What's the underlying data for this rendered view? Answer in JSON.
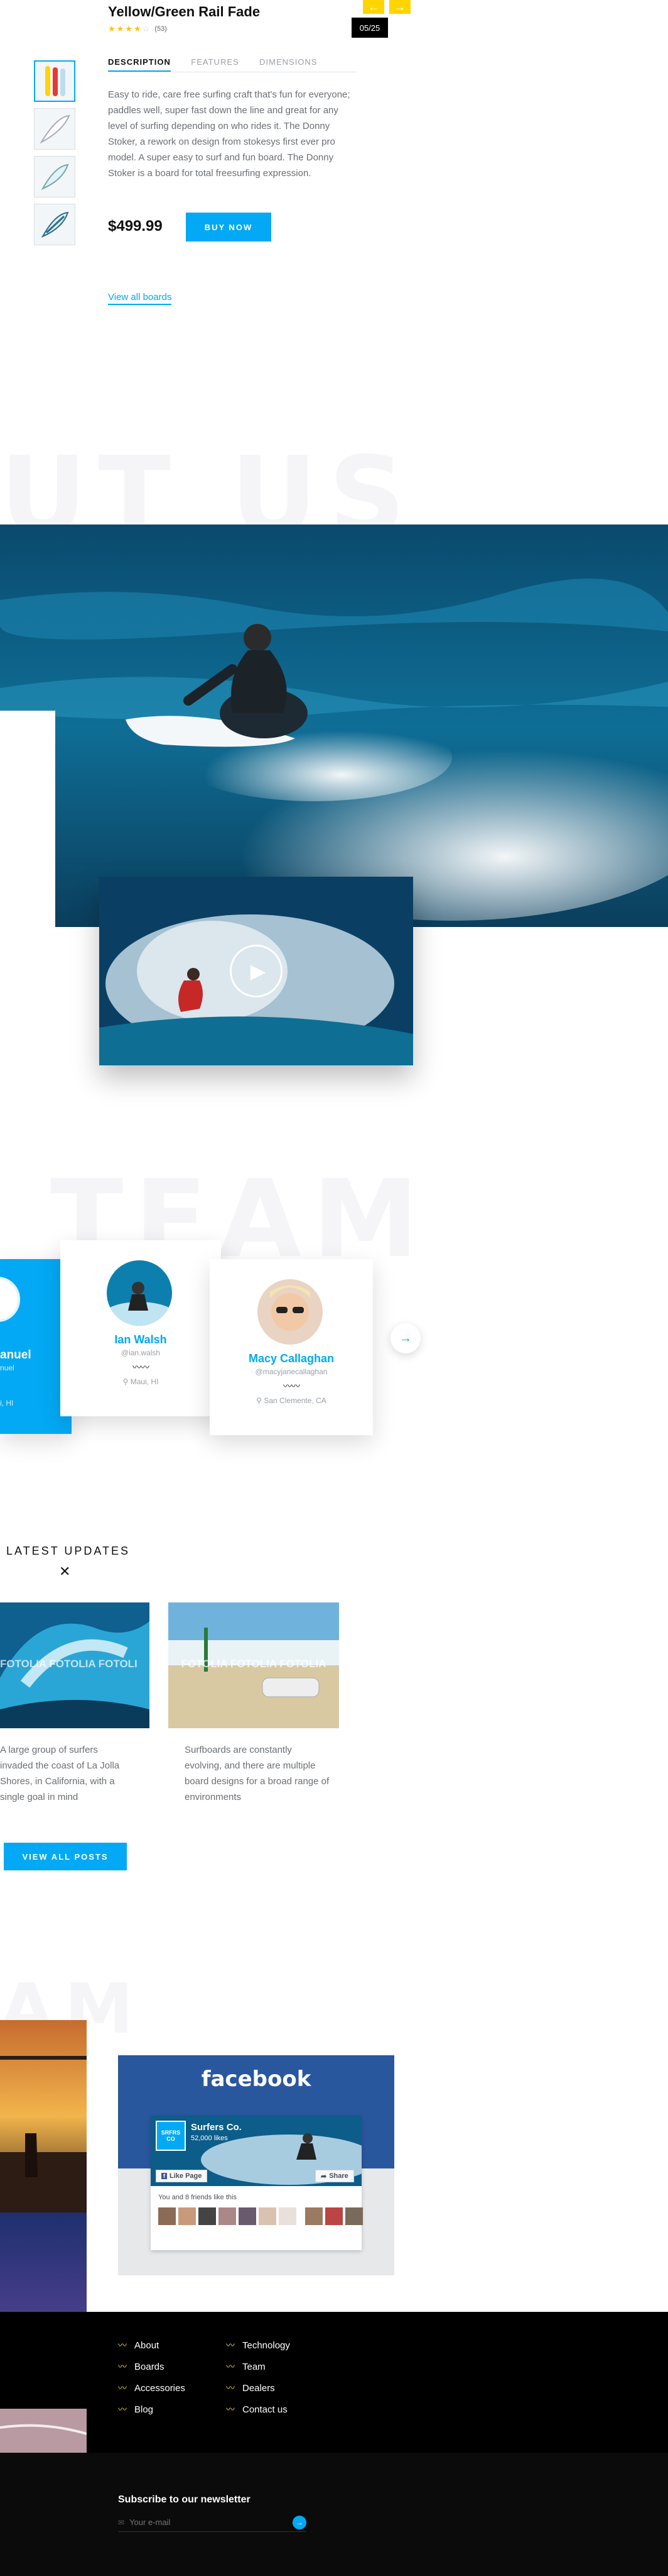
{
  "product": {
    "title": "Yellow/Green Rail Fade",
    "rating_stars": 4,
    "rating_count": "(53)",
    "counter": "05/25",
    "tabs": [
      "DESCRIPTION",
      "FEATURES",
      "DIMENSIONS"
    ],
    "description": "Easy to ride, care free surfing craft that's fun for everyone; paddles well, super fast down the line and great for any level of surfing depending on who rides it. The Donny Stoker, a rework on design from stokesys first ever pro model. A super easy to surf and fun board. The Donny Stoker is a board for total freesurfing expression.",
    "price": "$499.99",
    "buy_label": "BUY NOW",
    "view_all": "View all boards"
  },
  "about": {
    "bg_word": "UT US"
  },
  "team": {
    "bg_word": "TEAM",
    "members": [
      {
        "name": "anuel",
        "handle": "nuel",
        "location": "i, HI"
      },
      {
        "name": "Ian Walsh",
        "handle": "@ian.walsh",
        "location": "Maui, HI"
      },
      {
        "name": "Macy Callaghan",
        "handle": "@macyjanecallaghan",
        "location": "San Clemente, CA"
      }
    ]
  },
  "updates": {
    "heading": "LATEST UPDATES",
    "posts": [
      {
        "watermark": "FOTOLIA FOTOLIA FOTOLI",
        "text": "A large group of surfers invaded the coast of La Jolla Shores, in California, with a single goal in mind"
      },
      {
        "watermark": "FOTOLIA FOTOLIA FOTOLIA",
        "text": "Surfboards are constantly evolving, and there are multiple board designs for a broad range of environments"
      }
    ],
    "view_all_label": "VIEW ALL POSTS"
  },
  "gallery": {
    "bg_word": "AM"
  },
  "facebook": {
    "logo": "facebook",
    "page_name": "Surfers Co.",
    "likes": "52,000 likes",
    "badge": "SRFRS CO",
    "like_label": "Like Page",
    "share_label": "Share",
    "friends_text": "You and 8 friends like this"
  },
  "footer": {
    "col1": [
      "About",
      "Boards",
      "Accessories",
      "Blog"
    ],
    "col2": [
      "Technology",
      "Team",
      "Dealers",
      "Contact us"
    ],
    "newsletter_title": "Subscribe to our newsletter",
    "email_placeholder": "Your e-mail"
  },
  "colors": {
    "accent": "#03a9f4",
    "yellow": "#ffd400",
    "facebook": "#29579e",
    "footer_bg": "#000000"
  }
}
